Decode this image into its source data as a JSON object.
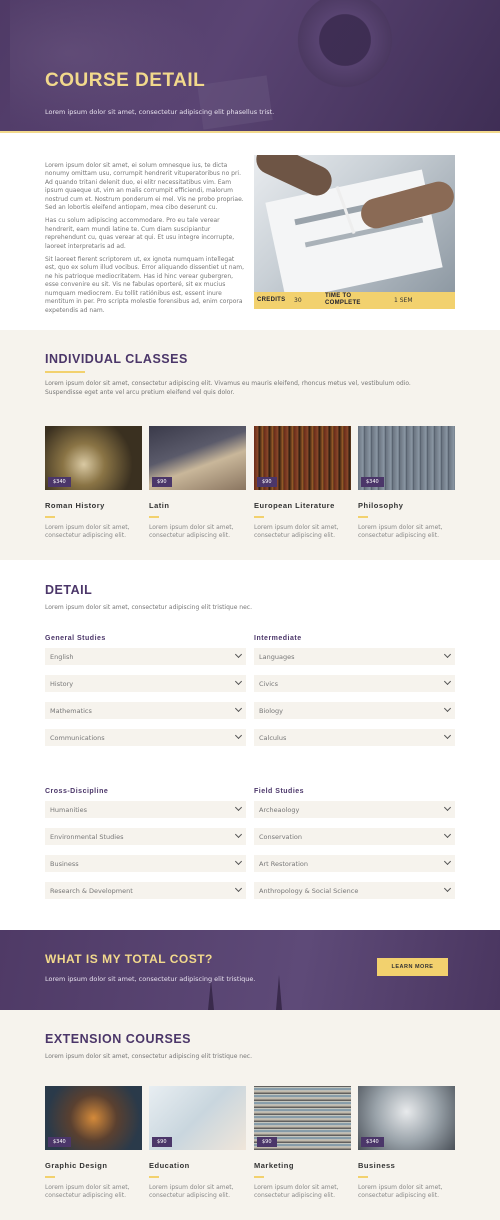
{
  "hero": {
    "title": "COURSE DETAIL",
    "subtitle": "Lorem ipsum dolor sit amet, consectetur adipiscing elit phasellus trist."
  },
  "intro": {
    "paragraphs": [
      "Lorem ipsum dolor sit amet, ei solum omnesque ius, te dicta nonumy omittam usu, corrumpit hendrerit vituperatoribus no pri. Ad quando tritani delenit duo, ei elitr necessitatibus vim. Eam ipsum quaeque ut, vim an malis corrumpit efficiendi, malorum nostrud cum et. Nostrum ponderum ei mel. Vis ne probo propriae. Sed an lobortis eleifend antiopam, mea cibo deserunt cu.",
      "Has cu solum adipiscing accommodare. Pro eu tale verear hendrerit, eam mundi latine te. Cum diam suscipiantur reprehendunt cu, quas verear at qui. Et usu integre incorrupte, laoreet interpretaris ad ad.",
      "Sit laoreet fierent scriptorem ut, ex ignota numquam intellegat est, quo ex solum illud vocibus. Error aliquando dissentiet ut nam, ne his patrioque mediocritatem. Has id hinc verear gubergren, esse convenire eu sit. Vis ne fabulas oporteré, sit ex mucius numquam mediocrem. Eu tollit ratiónibus est, essent inure mentitum in per. Pro scripta molestie forensibus ad, enim corpora expetendis ad nam."
    ],
    "meta": {
      "credits_label": "CREDITS",
      "credits_value": "30",
      "time_label_line1": "TIME TO",
      "time_label_line2": "COMPLETE",
      "time_value": "1 SEM"
    }
  },
  "classes": {
    "title": "INDIVIDUAL CLASSES",
    "description": "Lorem ipsum dolor sit amet, consectetur adipiscing elit. Vivamus eu mauris eleifend, rhoncus metus vel, vestibulum odio. Suspendisse eget ante vel arcu pretium eleifend vel quis dolor.",
    "items": [
      {
        "name": "Roman History",
        "price": "$340",
        "desc": "Lorem ipsum dolor sit amet, consectetur adipiscing elit."
      },
      {
        "name": "Latin",
        "price": "$90",
        "desc": "Lorem ipsum dolor sit amet, consectetur adipiscing elit."
      },
      {
        "name": "European Literature",
        "price": "$90",
        "desc": "Lorem ipsum dolor sit amet, consectetur adipiscing elit."
      },
      {
        "name": "Philosophy",
        "price": "$340",
        "desc": "Lorem ipsum dolor sit amet, consectetur adipiscing elit."
      }
    ]
  },
  "detail": {
    "title": "DETAIL",
    "description": "Lorem ipsum dolor sit amet, consectetur adipiscing elit tristique nec.",
    "groups": [
      {
        "title": "General Studies",
        "options": [
          "English",
          "History",
          "Mathematics",
          "Communications"
        ]
      },
      {
        "title": "Intermediate",
        "options": [
          "Languages",
          "Civics",
          "Biology",
          "Calculus"
        ]
      },
      {
        "title": "Cross-Discipline",
        "options": [
          "Humanities",
          "Environmental Studies",
          "Business",
          "Research & Development"
        ]
      },
      {
        "title": "Field Studies",
        "options": [
          "Archeaology",
          "Conservation",
          "Art Restoration",
          "Anthropology & Social Science"
        ]
      }
    ]
  },
  "cost": {
    "title": "WHAT IS MY TOTAL COST?",
    "subtitle": "Lorem ipsum dolor sit amet, consectetur adipiscing elit tristique.",
    "button": "LEARN MORE"
  },
  "extension": {
    "title": "EXTENSION COURSES",
    "description": "Lorem ipsum dolor sit amet, consectetur adipiscing elit tristique nec.",
    "items": [
      {
        "name": "Graphic Design",
        "price": "$340",
        "desc": "Lorem ipsum dolor sit amet, consectetur adipiscing elit."
      },
      {
        "name": "Education",
        "price": "$90",
        "desc": "Lorem ipsum dolor sit amet, consectetur adipiscing elit."
      },
      {
        "name": "Marketing",
        "price": "$90",
        "desc": "Lorem ipsum dolor sit amet, consectetur adipiscing elit."
      },
      {
        "name": "Business",
        "price": "$340",
        "desc": "Lorem ipsum dolor sit amet, consectetur adipiscing elit."
      }
    ]
  },
  "colors": {
    "purple": "#4b3669",
    "gold": "#f2d16e",
    "cream": "#f6f3ed"
  }
}
